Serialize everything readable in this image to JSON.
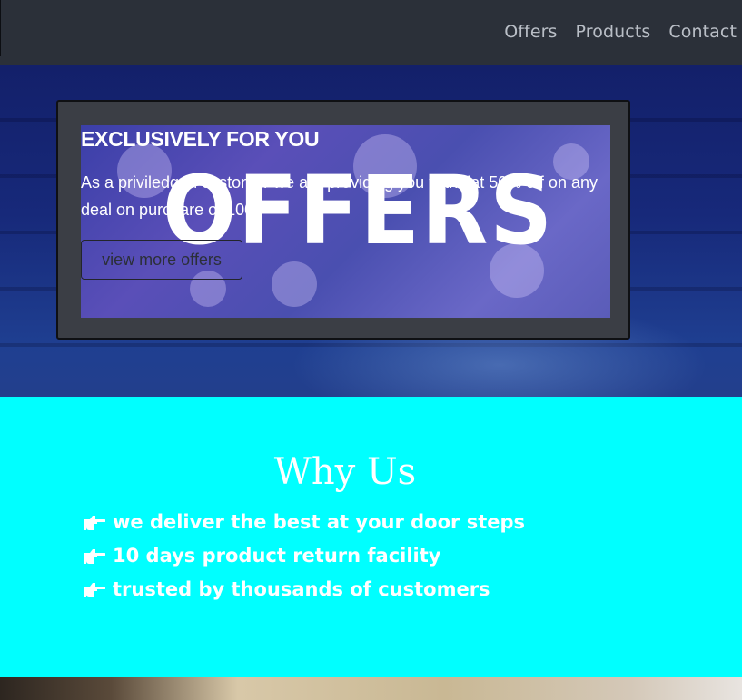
{
  "nav": {
    "links": [
      "Offers",
      "Products",
      "Contact"
    ]
  },
  "offer_card": {
    "title": "EXCLUSIVELY FOR YOU",
    "text": "As a priviledged costomer we are providing you with flat 50% off on any deal on purchare of 1000",
    "image_word": "OFFERS",
    "button_label": "view more offers"
  },
  "why_us": {
    "title": "Why Us",
    "items": [
      "we deliver the best at your door steps",
      "10 days product return facility",
      "trusted by thousands of customers"
    ],
    "item_icon": "pointing-hand-icon"
  },
  "colors": {
    "navbar": "#2b3039",
    "hero": "#17297a",
    "why_background": "#00ffff",
    "text": "#ffffff"
  }
}
